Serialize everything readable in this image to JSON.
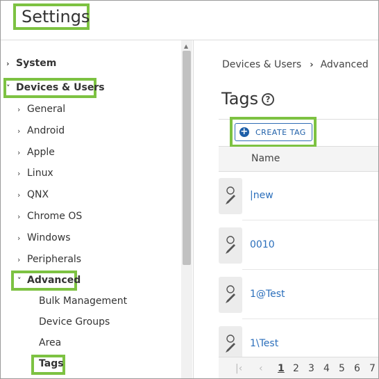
{
  "header": {
    "title": "Settings"
  },
  "sidebar": {
    "items": [
      {
        "label": "System",
        "chevron": "›"
      },
      {
        "label": "Devices & Users",
        "chevron": "˅"
      },
      {
        "label": "General",
        "chevron": "›"
      },
      {
        "label": "Android",
        "chevron": "›"
      },
      {
        "label": "Apple",
        "chevron": "›"
      },
      {
        "label": "Linux",
        "chevron": "›"
      },
      {
        "label": "QNX",
        "chevron": "›"
      },
      {
        "label": "Chrome OS",
        "chevron": "›"
      },
      {
        "label": "Windows",
        "chevron": "›"
      },
      {
        "label": "Peripherals",
        "chevron": "›"
      },
      {
        "label": "Advanced",
        "chevron": "˅"
      },
      {
        "label": "Bulk Management"
      },
      {
        "label": "Device Groups"
      },
      {
        "label": "Area"
      },
      {
        "label": "Tags"
      }
    ]
  },
  "breadcrumb": {
    "parent": "Devices & Users",
    "separator": "›",
    "current": "Advanced"
  },
  "main": {
    "title": "Tags",
    "help_glyph": "?",
    "create_button": {
      "icon": "+",
      "label": "CREATE TAG"
    },
    "column_header": "Name",
    "rows": [
      "|new",
      "0010",
      "1@Test",
      "1\\Test"
    ],
    "pager": {
      "first": "|‹",
      "prev": "‹",
      "pages": [
        "1",
        "2",
        "3",
        "4",
        "5",
        "6",
        "7"
      ]
    }
  },
  "colors": {
    "highlight": "#7dc242",
    "link": "#2a6ebb",
    "button": "#1e5fa8"
  }
}
